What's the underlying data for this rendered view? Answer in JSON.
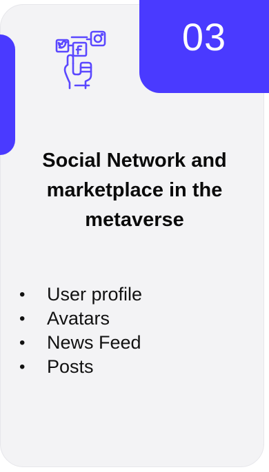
{
  "card": {
    "number": "03",
    "title": "Social Network and marketplace in the metaverse",
    "bullet_glyph": "•",
    "items": [
      {
        "label": "User profile"
      },
      {
        "label": "Avatars"
      },
      {
        "label": "News Feed"
      },
      {
        "label": "Posts"
      }
    ]
  },
  "icon": "social-media-hand-icon",
  "colors": {
    "accent": "#4a3aff",
    "card_bg": "#f3f3f5",
    "text": "#0a0a0a"
  }
}
